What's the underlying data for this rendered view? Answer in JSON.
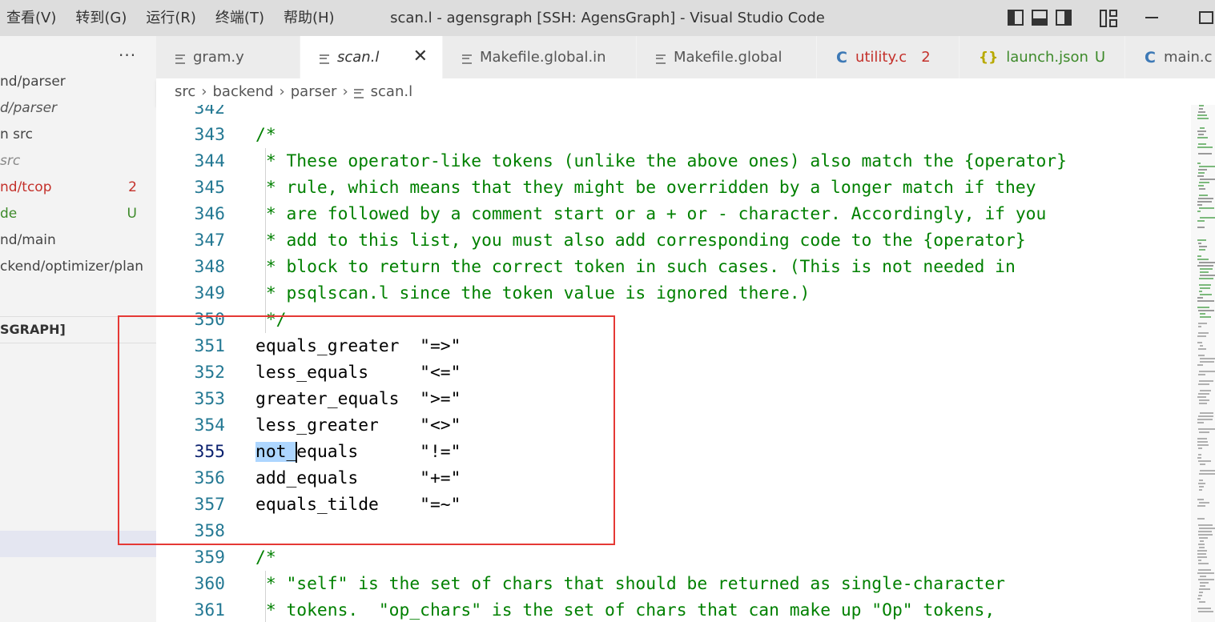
{
  "titlebar": {
    "menu": [
      "查看(V)",
      "转到(G)",
      "运行(R)",
      "终端(T)",
      "帮助(H)"
    ],
    "window_title": "scan.l - agensgraph [SSH: AgensGraph] - Visual Studio Code"
  },
  "sidebar": {
    "more_label": "···",
    "items": [
      {
        "label": "nd/parser",
        "color": "#444444",
        "badge": ""
      },
      {
        "label": "d/parser",
        "color": "#555555",
        "badge": "",
        "italic": true
      },
      {
        "label": "n  src",
        "color": "#444444",
        "badge": ""
      },
      {
        "label": "src",
        "color": "#888888",
        "badge": "",
        "italic": true
      },
      {
        "label": "nd/tcop",
        "color": "#c4312b",
        "badge": "2"
      },
      {
        "label": "de",
        "color": "#3d8a2a",
        "badge": "U"
      },
      {
        "label": "nd/main",
        "color": "#444444",
        "badge": ""
      },
      {
        "label": "ckend/optimizer/plan",
        "color": "#444444",
        "badge": ""
      }
    ],
    "section_label": "SGRAPH]"
  },
  "tabs": [
    {
      "label": "gram.y",
      "icon": "file-lines-icon",
      "active": false,
      "badge": "",
      "color": "#555555"
    },
    {
      "label": "scan.l",
      "icon": "file-lines-icon",
      "active": true,
      "badge": "",
      "color": "#333333"
    },
    {
      "label": "Makefile.global.in",
      "icon": "file-lines-icon",
      "active": false,
      "badge": "",
      "color": "#555555"
    },
    {
      "label": "Makefile.global",
      "icon": "file-lines-icon",
      "active": false,
      "badge": "",
      "color": "#555555"
    },
    {
      "label": "utility.c",
      "icon": "c-file-icon",
      "active": false,
      "badge": "2",
      "color": "#c4312b"
    },
    {
      "label": "launch.json",
      "icon": "json-file-icon",
      "active": false,
      "badge": "U",
      "color": "#3d8a2a"
    },
    {
      "label": "main.c",
      "icon": "c-file-icon",
      "active": false,
      "badge": "",
      "color": "#555555"
    }
  ],
  "breadcrumb": [
    "src",
    "backend",
    "parser",
    "scan.l"
  ],
  "editor": {
    "lines": [
      {
        "num": "342",
        "text": "",
        "type": "normal"
      },
      {
        "num": "343",
        "text": "/*",
        "type": "comment"
      },
      {
        "num": "344",
        "text": " * These operator-like tokens (unlike the above ones) also match the {operator}",
        "type": "comment"
      },
      {
        "num": "345",
        "text": " * rule, which means that they might be overridden by a longer match if they",
        "type": "comment"
      },
      {
        "num": "346",
        "text": " * are followed by a comment start or a + or - character. Accordingly, if you",
        "type": "comment"
      },
      {
        "num": "347",
        "text": " * add to this list, you must also add corresponding code to the {operator}",
        "type": "comment"
      },
      {
        "num": "348",
        "text": " * block to return the correct token in such cases. (This is not needed in",
        "type": "comment"
      },
      {
        "num": "349",
        "text": " * psqlscan.l since the token value is ignored there.)",
        "type": "comment"
      },
      {
        "num": "350",
        "text": " */",
        "type": "comment"
      },
      {
        "num": "351",
        "text": "equals_greater  \"=>\"",
        "type": "normal"
      },
      {
        "num": "352",
        "text": "less_equals     \"<=\"",
        "type": "normal"
      },
      {
        "num": "353",
        "text": "greater_equals  \">=\"",
        "type": "normal"
      },
      {
        "num": "354",
        "text": "less_greater    \"<>\"",
        "type": "normal"
      },
      {
        "num": "355",
        "text": "not_equals      \"!=\"",
        "type": "normal",
        "current": true
      },
      {
        "num": "356",
        "text": "add_equals      \"+=\"",
        "type": "normal"
      },
      {
        "num": "357",
        "text": "equals_tilde    \"=~\"",
        "type": "normal"
      },
      {
        "num": "358",
        "text": "",
        "type": "normal"
      },
      {
        "num": "359",
        "text": "/*",
        "type": "comment"
      },
      {
        "num": "360",
        "text": " * \"self\" is the set of chars that should be returned as single-character",
        "type": "comment"
      },
      {
        "num": "361",
        "text": " * tokens.  \"op_chars\" is the set of chars that can make up \"Op\" tokens,",
        "type": "comment"
      }
    ],
    "selection": {
      "selected_text": "not_",
      "rest_text": "equals      \"!=\""
    },
    "colors": {
      "comment": "#008000",
      "line_number": "#237893",
      "highlight_box": "#e53935",
      "selection": "#add6ff"
    }
  }
}
